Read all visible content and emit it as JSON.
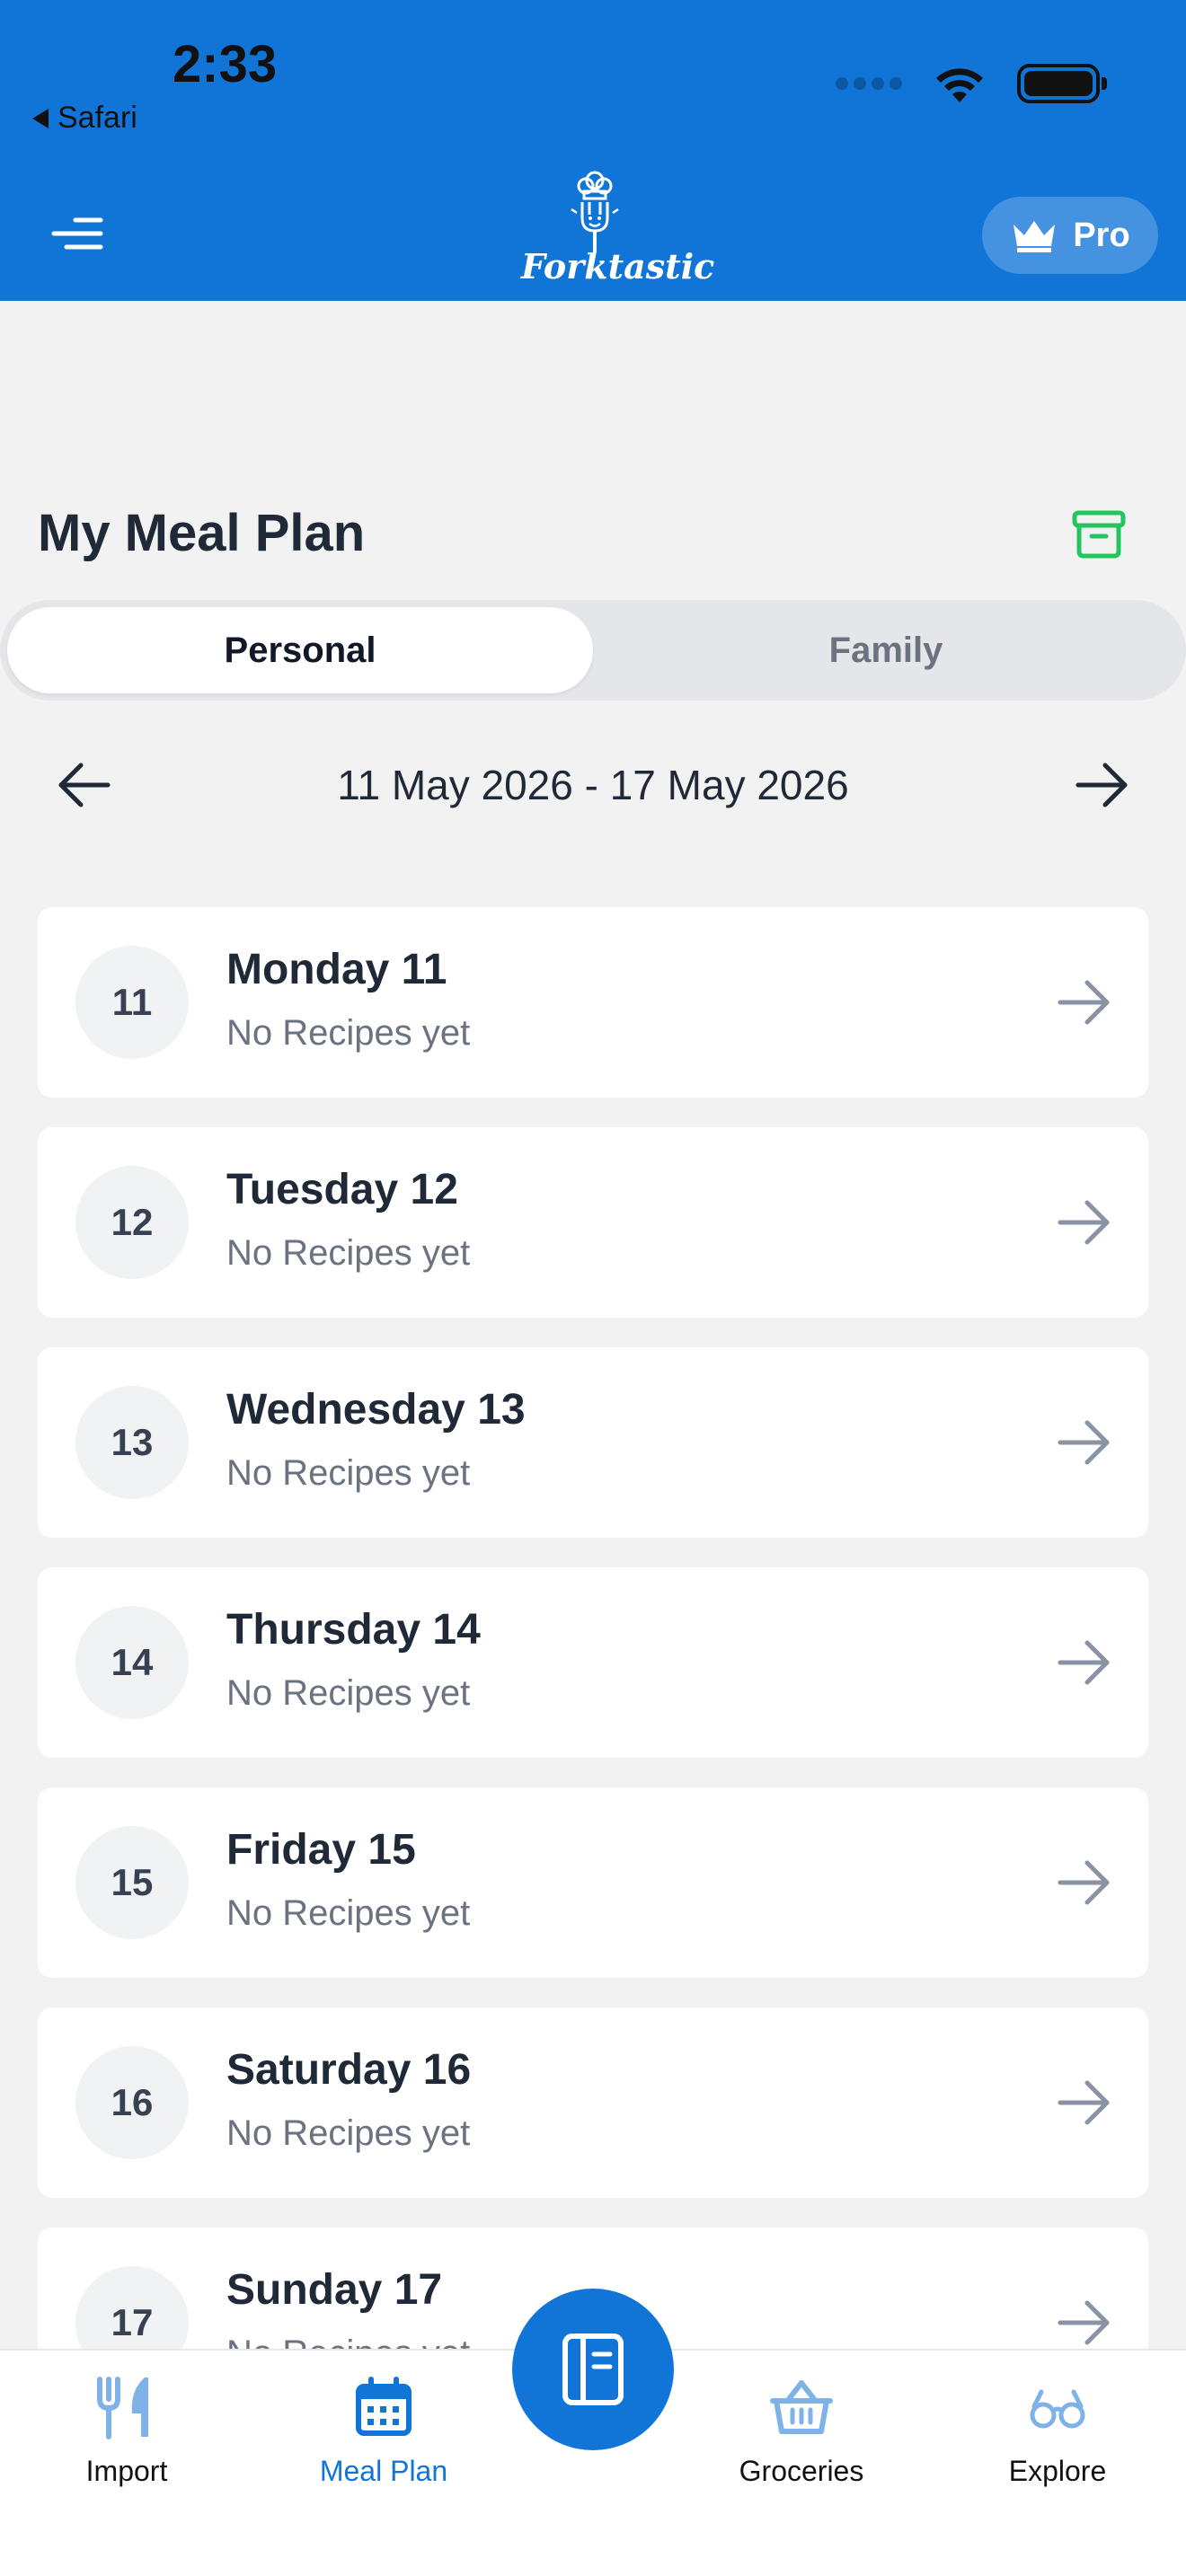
{
  "status_bar": {
    "time": "2:33",
    "back_app": "Safari"
  },
  "header": {
    "logo_text": "Forktastic",
    "pro_label": "Pro"
  },
  "page": {
    "title": "My Meal Plan"
  },
  "segments": {
    "personal": "Personal",
    "family": "Family",
    "selected": "Personal"
  },
  "week": {
    "range": "11 May 2026 - 17 May 2026"
  },
  "days": [
    {
      "num": "11",
      "name": "Monday 11",
      "sub": "No Recipes yet"
    },
    {
      "num": "12",
      "name": "Tuesday 12",
      "sub": "No Recipes yet"
    },
    {
      "num": "13",
      "name": "Wednesday 13",
      "sub": "No Recipes yet"
    },
    {
      "num": "14",
      "name": "Thursday 14",
      "sub": "No Recipes yet"
    },
    {
      "num": "15",
      "name": "Friday 15",
      "sub": "No Recipes yet"
    },
    {
      "num": "16",
      "name": "Saturday 16",
      "sub": "No Recipes yet"
    },
    {
      "num": "17",
      "name": "Sunday 17",
      "sub": "No Recipes yet"
    }
  ],
  "bottom_nav": {
    "import": "Import",
    "meal_plan": "Meal Plan",
    "groceries": "Groceries",
    "explore": "Explore",
    "active": "Meal Plan"
  },
  "colors": {
    "brand": "#1175d8",
    "archive": "#22c55e",
    "background": "#f2f2f2"
  },
  "icons": [
    "menu-icon",
    "crown-icon",
    "archive-icon",
    "arrow-left-icon",
    "arrow-right-icon",
    "fork-knife-icon",
    "calendar-icon",
    "recipe-book-icon",
    "basket-icon",
    "glasses-icon",
    "wifi-icon",
    "battery-icon"
  ]
}
